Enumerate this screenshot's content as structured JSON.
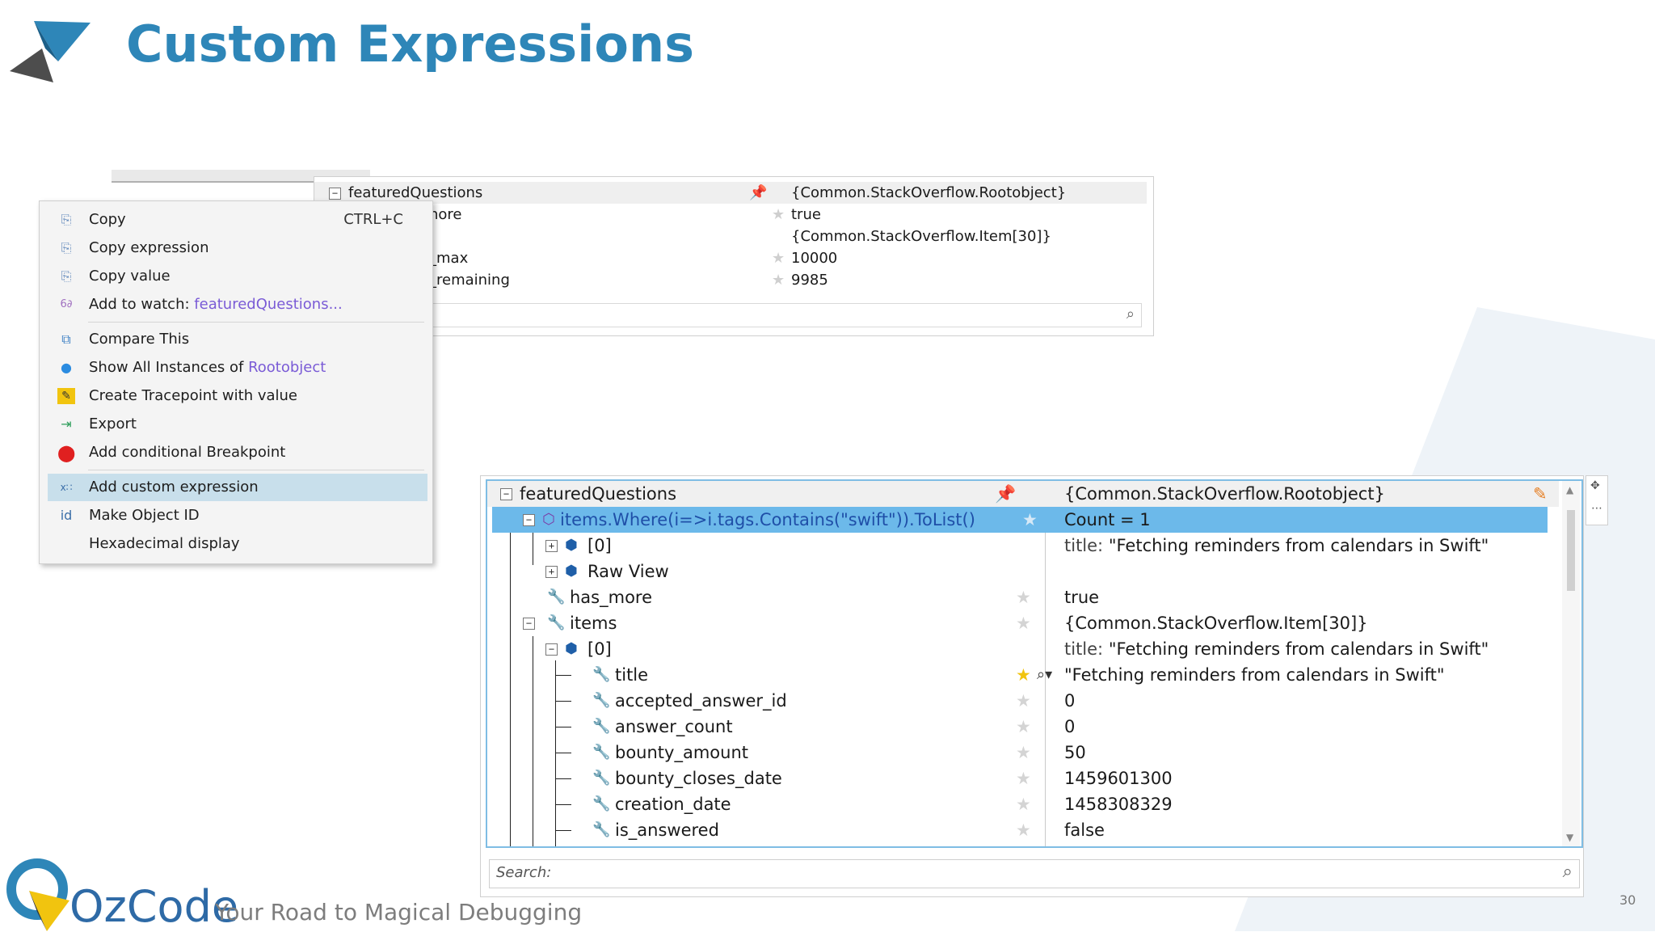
{
  "slide": {
    "title": "Custom Expressions",
    "page_number": "30"
  },
  "brand": {
    "name": "OzCode",
    "tagline": "Your Road to Magical Debugging",
    "accent": "#2e86b8"
  },
  "bg_watch": {
    "header": {
      "name": "featuredQuestions",
      "value": "{Common.StackOverflow.Rootobject}"
    },
    "rows": [
      {
        "name": "nore",
        "value": "true"
      },
      {
        "name": "",
        "value": "{Common.StackOverflow.Item[30]}"
      },
      {
        "name": "_max",
        "value": "10000"
      },
      {
        "name": "_remaining",
        "value": "9985"
      }
    ]
  },
  "context_menu": {
    "copy": "Copy",
    "copy_shortcut": "CTRL+C",
    "copy_expression": "Copy expression",
    "copy_value": "Copy value",
    "add_to_watch": "Add to watch:",
    "add_to_watch_target": "featuredQuestions...",
    "compare_this": "Compare This",
    "show_all_instances": "Show All Instances of",
    "show_all_instances_target": "Rootobject",
    "create_tracepoint": "Create Tracepoint with value",
    "export": "Export",
    "add_conditional_breakpoint": "Add conditional Breakpoint",
    "add_custom_expression": "Add custom expression",
    "make_object_id": "Make Object ID",
    "hexadecimal_display": "Hexadecimal display"
  },
  "watch": {
    "rows": [
      {
        "name": "featuredQuestions",
        "value": "{Common.StackOverflow.Rootobject}"
      },
      {
        "name": "items.Where(i=>i.tags.Contains(\"swift\")).ToList()",
        "value": "Count = 1"
      },
      {
        "name": "[0]",
        "value_prefix": "title:",
        "value": "\"Fetching reminders from calendars in Swift\""
      },
      {
        "name": "Raw View",
        "value": ""
      },
      {
        "name": "has_more",
        "value": "true"
      },
      {
        "name": "items",
        "value": "{Common.StackOverflow.Item[30]}"
      },
      {
        "name": "[0]",
        "value_prefix": "title:",
        "value": "\"Fetching reminders from calendars in Swift\""
      },
      {
        "name": "title",
        "value": "\"Fetching reminders from calendars in Swift\""
      },
      {
        "name": "accepted_answer_id",
        "value": "0"
      },
      {
        "name": "answer_count",
        "value": "0"
      },
      {
        "name": "bounty_amount",
        "value": "50"
      },
      {
        "name": "bounty_closes_date",
        "value": "1459601300"
      },
      {
        "name": "creation_date",
        "value": "1458308329"
      },
      {
        "name": "is_answered",
        "value": "false"
      }
    ],
    "search_placeholder": "Search:"
  }
}
